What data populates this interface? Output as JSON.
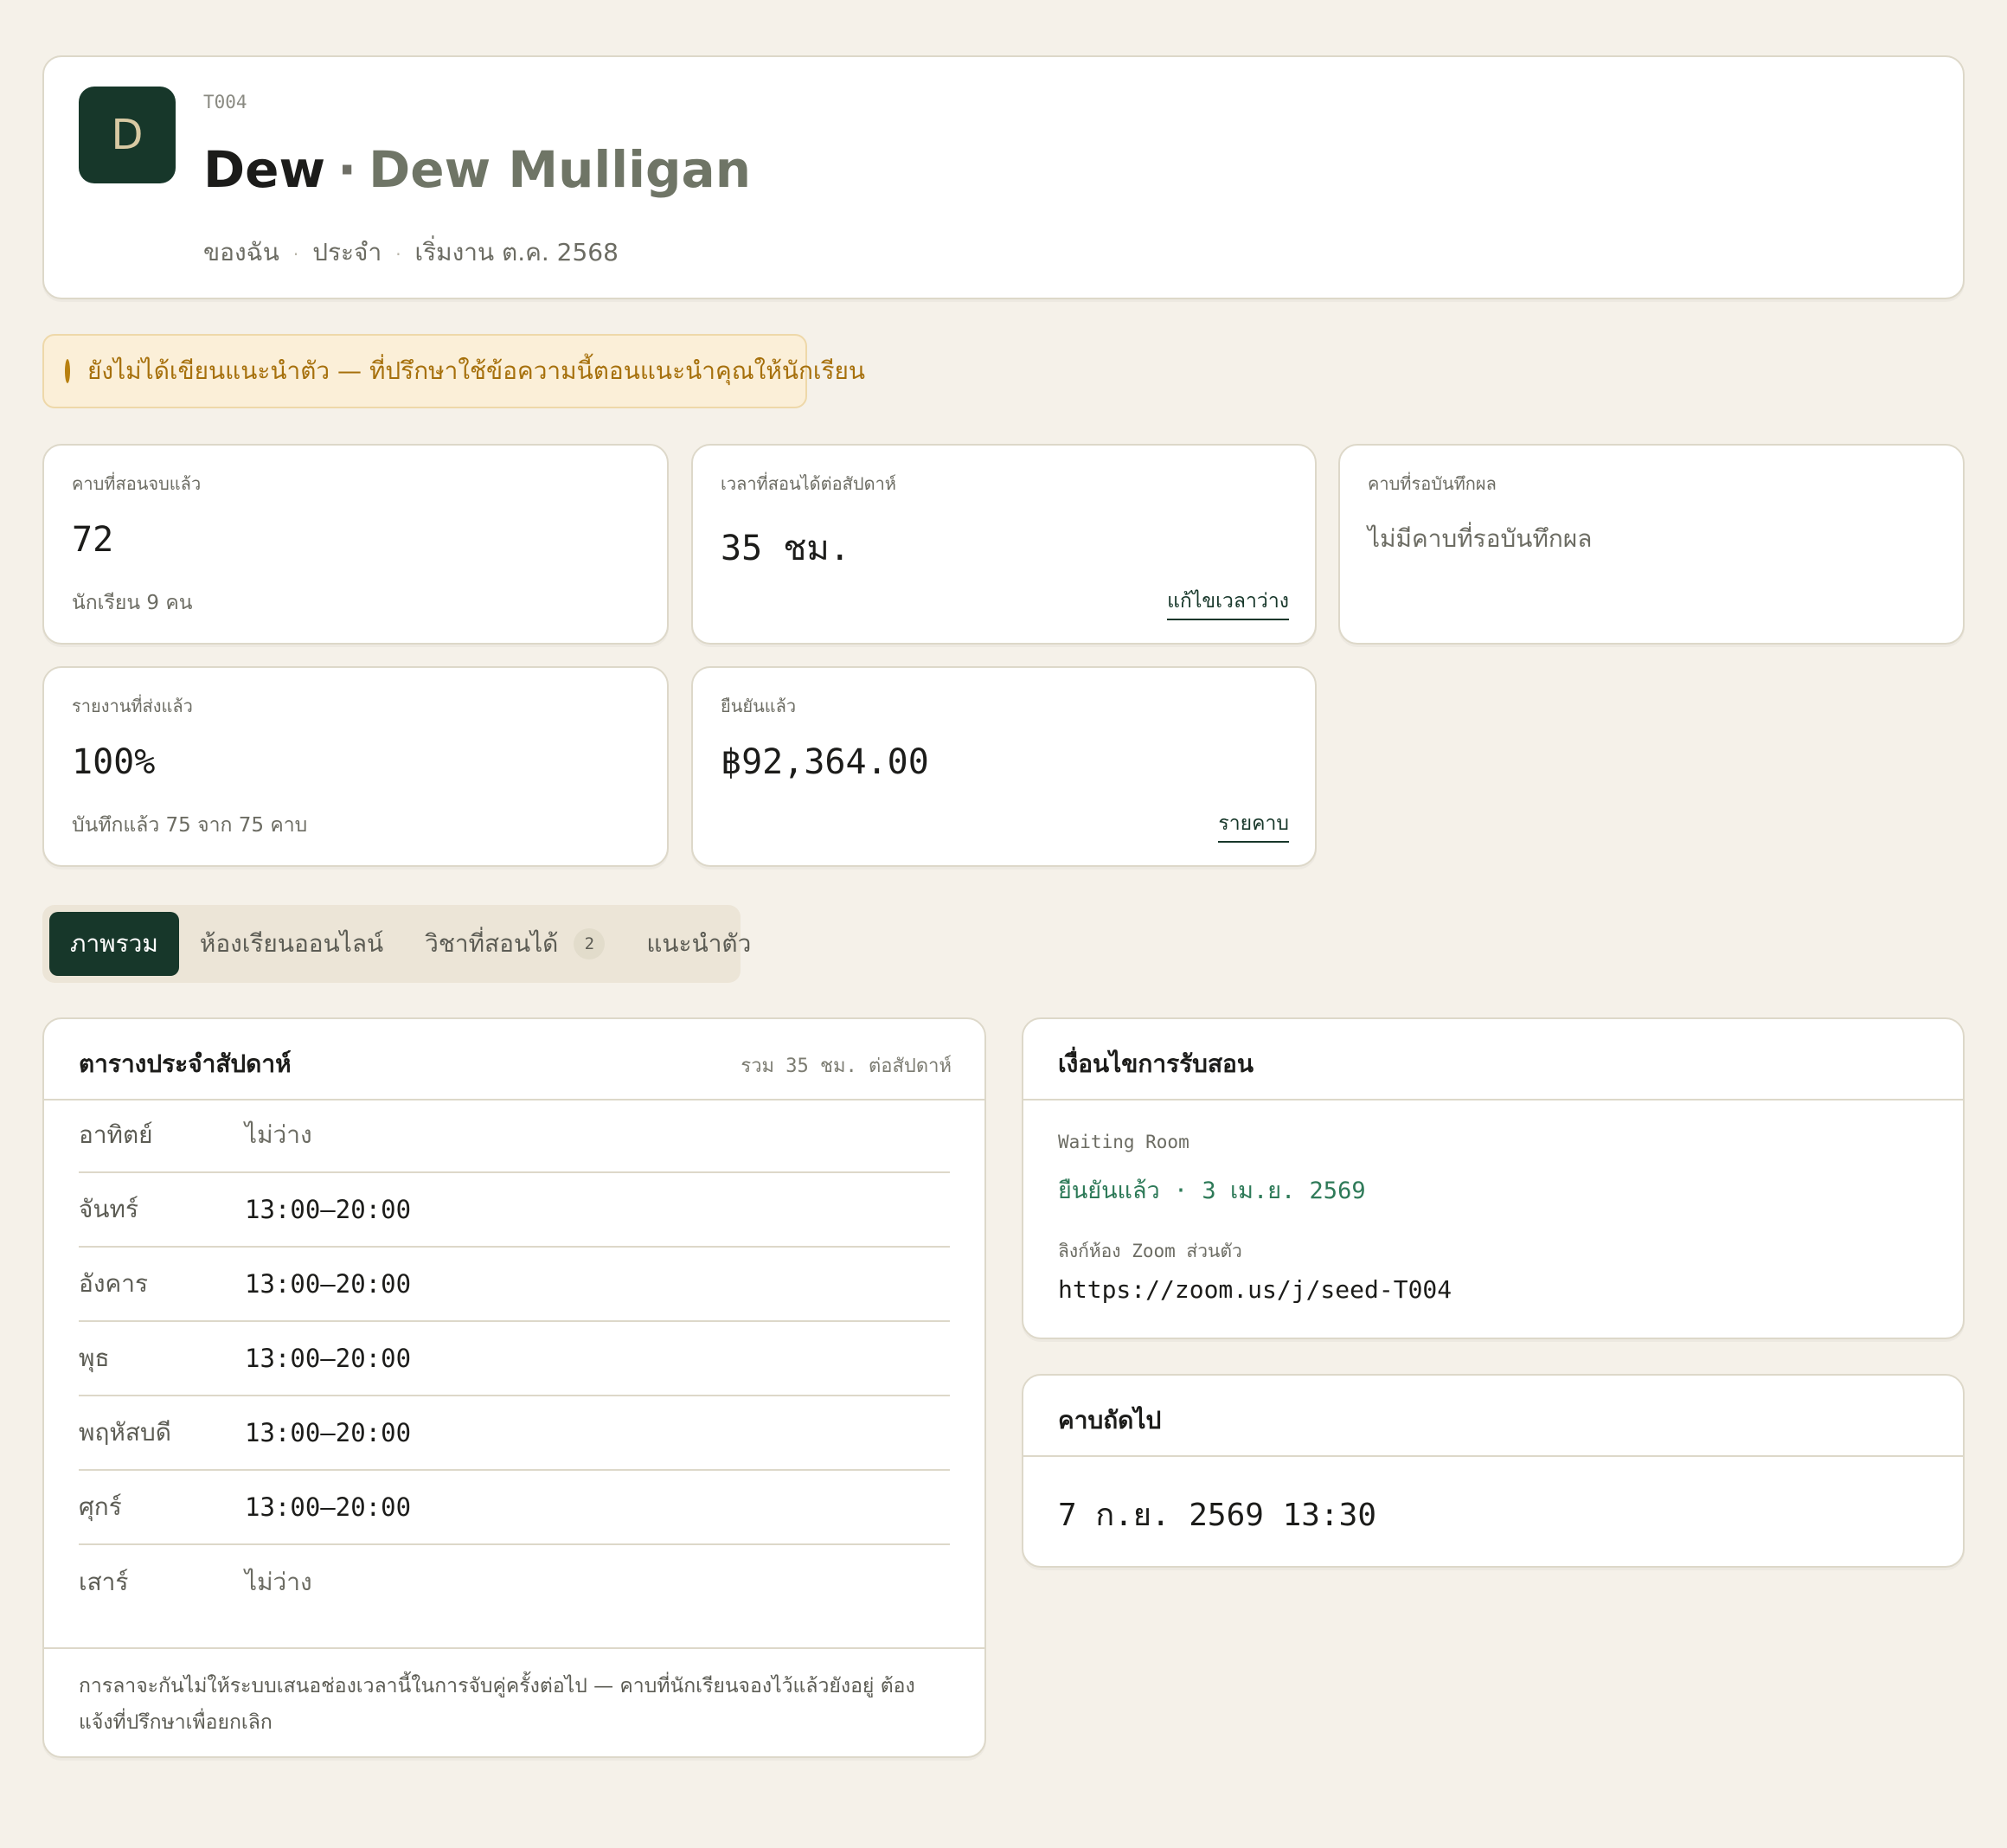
{
  "profile": {
    "avatar_letter": "D",
    "code": "T004",
    "nickname": "Dew",
    "separator": "·",
    "full_name": "Dew Mulligan",
    "meta": [
      "ของฉัน",
      "ประจำ",
      "เริ่มงาน ต.ค. 2568"
    ]
  },
  "alert": {
    "icon": "circle-outline-icon",
    "text": "ยังไม่ได้เขียนแนะนำตัว — ที่ปรึกษาใช้ข้อความนี้ตอนแนะนำคุณให้นักเรียน"
  },
  "stats": {
    "completed": {
      "label": "คาบที่สอนจบแล้ว",
      "value": "72",
      "sub": "นักเรียน 9 คน"
    },
    "hours": {
      "label": "เวลาที่สอนได้ต่อสัปดาห์",
      "value": "35 ชม.",
      "link": "แก้ไขเวลาว่าง"
    },
    "pending": {
      "label": "คาบที่รอบันทึกผล",
      "empty": "ไม่มีคาบที่รอบันทึกผล"
    },
    "reports": {
      "label": "รายงานที่ส่งแล้ว",
      "value": "100%",
      "sub": "บันทึกแล้ว 75 จาก 75 คาบ"
    },
    "confirmed": {
      "label": "ยืนยันแล้ว",
      "value": "฿92,364.00",
      "link": "รายคาบ"
    }
  },
  "tabs": [
    {
      "label": "ภาพรวม",
      "active": true
    },
    {
      "label": "ห้องเรียนออนไลน์"
    },
    {
      "label": "วิชาที่สอนได้",
      "badge": "2"
    },
    {
      "label": "แนะนำตัว"
    }
  ],
  "schedule": {
    "title": "ตารางประจำสัปดาห์",
    "total": "รวม 35 ชม. ต่อสัปดาห์",
    "rows": [
      {
        "day": "อาทิตย์",
        "time": "ไม่ว่าง"
      },
      {
        "day": "จันทร์",
        "time": "13:00–20:00"
      },
      {
        "day": "อังคาร",
        "time": "13:00–20:00"
      },
      {
        "day": "พุธ",
        "time": "13:00–20:00"
      },
      {
        "day": "พฤหัสบดี",
        "time": "13:00–20:00"
      },
      {
        "day": "ศุกร์",
        "time": "13:00–20:00"
      },
      {
        "day": "เสาร์",
        "time": "ไม่ว่าง"
      }
    ],
    "note": "การลาจะกันไม่ให้ระบบเสนอช่องเวลานี้ในการจับคู่ครั้งต่อไป — คาบที่นักเรียนจองไว้แล้วยังอยู่ ต้องแจ้งที่ปรึกษาเพื่อยกเลิก"
  },
  "conditions": {
    "title": "เงื่อนไขการรับสอน",
    "waiting_label": "Waiting Room",
    "waiting_status": "ยืนยันแล้ว · 3 เม.ย. 2569",
    "zoom_label": "ลิงก์ห้อง Zoom ส่วนตัว",
    "zoom_link": "https://zoom.us/j/seed-T004"
  },
  "next_session": {
    "title": "คาบถัดไป",
    "value": "7 ก.ย. 2569 13:30"
  },
  "colors": {
    "accent": "#17372a",
    "background": "#f5f1e9",
    "alert_bg": "#fbefd8",
    "alert_text": "#a6700c",
    "success": "#2e7a58"
  }
}
